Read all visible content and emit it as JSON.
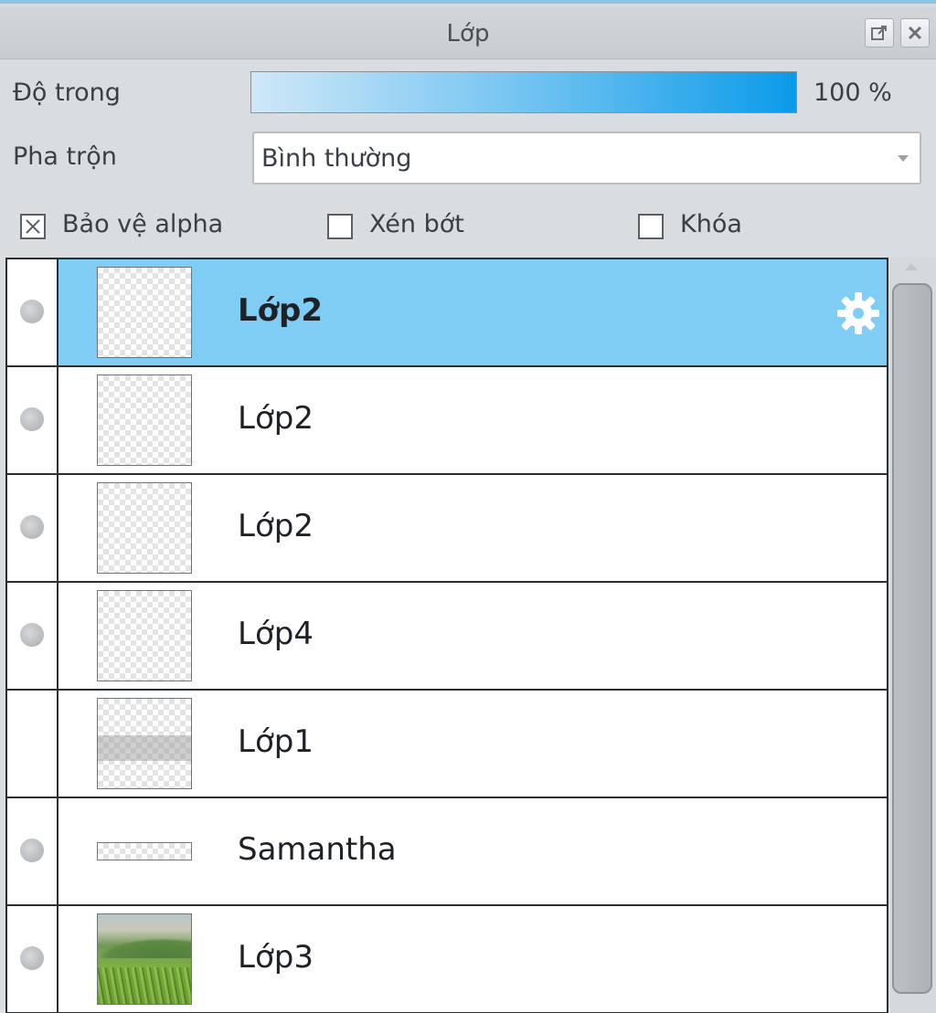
{
  "panel": {
    "title": "Lớp"
  },
  "opacity": {
    "label": "Độ trong",
    "value_text": "100 %",
    "value": 100
  },
  "blend": {
    "label": "Pha trộn",
    "selected": "Bình thường"
  },
  "options": {
    "protect_alpha": {
      "label": "Bảo vệ alpha",
      "checked": true
    },
    "clip": {
      "label": "Xén bớt",
      "checked": false
    },
    "lock": {
      "label": "Khóa",
      "checked": false
    }
  },
  "layers": [
    {
      "name": "Lớp2",
      "selected": true,
      "visible_dot": true,
      "thumb": "checker"
    },
    {
      "name": "Lớp2",
      "selected": false,
      "visible_dot": true,
      "thumb": "checker"
    },
    {
      "name": "Lớp2",
      "selected": false,
      "visible_dot": true,
      "thumb": "checker"
    },
    {
      "name": "Lớp4",
      "selected": false,
      "visible_dot": true,
      "thumb": "checker"
    },
    {
      "name": "Lớp1",
      "selected": false,
      "visible_dot": false,
      "thumb": "checker-band"
    },
    {
      "name": "Samantha",
      "selected": false,
      "visible_dot": true,
      "thumb": "strip"
    },
    {
      "name": "Lớp3",
      "selected": false,
      "visible_dot": true,
      "thumb": "landscape"
    }
  ],
  "colors": {
    "selected_row": "#7fcdf4",
    "opacity_fill": "#0b9be9"
  }
}
